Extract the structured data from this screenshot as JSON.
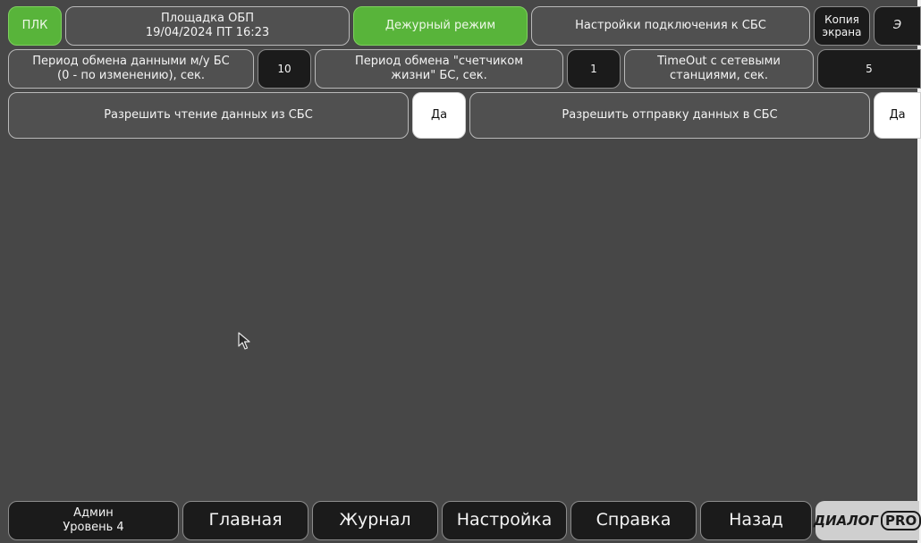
{
  "header": {
    "plc_label": "ПЛК",
    "site_name": "Площадка ОБП",
    "datetime": "19/04/2024 ПТ 16:23",
    "mode_label": "Дежурный режим",
    "page_title": "Настройки подключения к СБС",
    "screen_copy_label_1": "Копия",
    "screen_copy_label_2": "экрана",
    "e_button_label": "Э"
  },
  "settings": {
    "exchange_period_label_1": "Период обмена данными м/у БС",
    "exchange_period_label_2": "(0 - по изменению), сек.",
    "exchange_period_value": "10",
    "heartbeat_period_label_1": "Период обмена \"счетчиком",
    "heartbeat_period_label_2": "жизни\" БС, сек.",
    "heartbeat_period_value": "1",
    "timeout_label_1": "TimeOut с сетевыми",
    "timeout_label_2": "станциями, сек.",
    "timeout_value": "5",
    "allow_read_label": "Разрешить чтение данных из СБС",
    "allow_read_value": "Да",
    "allow_send_label": "Разрешить отправку данных в СБС",
    "allow_send_value": "Да"
  },
  "footer": {
    "user_name": "Админ",
    "user_level": "Уровень 4",
    "nav_main": "Главная",
    "nav_journal": "Журнал",
    "nav_settings": "Настройка",
    "nav_help": "Справка",
    "nav_back": "Назад",
    "logo_text": "ДИАЛОГ",
    "logo_pro": "PRO"
  },
  "colors": {
    "background": "#474747",
    "panel": "#505050",
    "dark_value": "#1b1b1b",
    "active_green": "#58b43a",
    "value_white": "#ffffff"
  }
}
